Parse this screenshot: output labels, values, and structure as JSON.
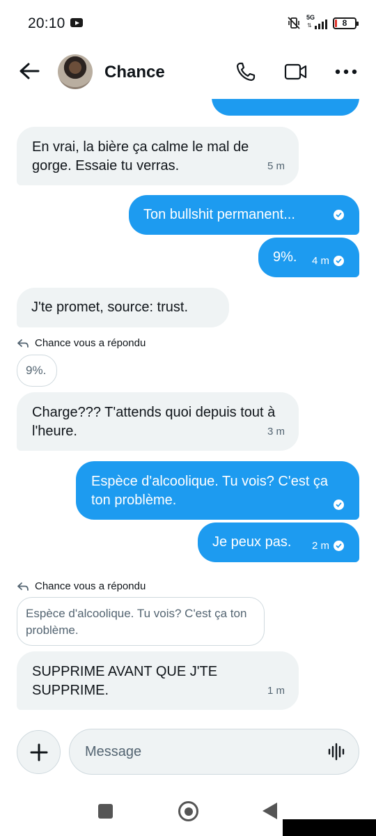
{
  "status_bar": {
    "time": "20:10",
    "network": "5G",
    "battery": "8"
  },
  "header": {
    "contact_name": "Chance"
  },
  "messages": {
    "m1": {
      "text": "En vrai, la bière ça calme le mal de gorge. Essaie tu verras.",
      "time": "5 m"
    },
    "m2": {
      "text": "Ton bullshit permanent..."
    },
    "m3": {
      "text": "9%.",
      "time": "4 m"
    },
    "m4": {
      "text": "J'te promet, source: trust."
    },
    "reply1": {
      "label": "Chance vous a répondu",
      "quote": "9%."
    },
    "m5": {
      "text": "Charge??? T'attends quoi depuis tout à l'heure.",
      "time": "3 m"
    },
    "m6": {
      "text": "Espèce d'alcoolique. Tu vois? C'est ça ton problème."
    },
    "m7": {
      "text": "Je peux pas.",
      "time": "2 m"
    },
    "reply2": {
      "label": "Chance vous a répondu",
      "quote": "Espèce d'alcoolique. Tu vois? C'est ça ton problème."
    },
    "m8": {
      "text": "SUPPRIME AVANT QUE J'TE SUPPRIME.",
      "time": "1 m"
    }
  },
  "composer": {
    "placeholder": "Message"
  },
  "icons": {
    "back": "arrow-left-icon",
    "call": "phone-icon",
    "video": "video-camera-icon",
    "more": "more-dots-icon",
    "add": "plus-icon",
    "voice": "waveform-icon",
    "read": "check-circle-icon"
  },
  "colors": {
    "sent_bubble": "#1d9bf0",
    "received_bubble": "#eff3f4",
    "secondary_text": "#536471"
  }
}
